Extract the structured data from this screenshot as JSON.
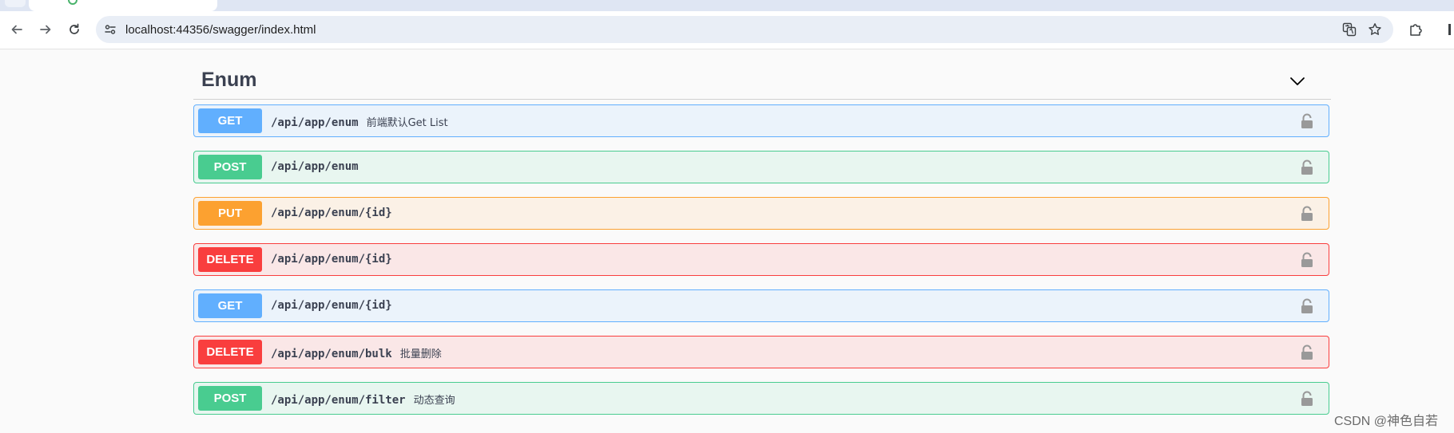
{
  "browser": {
    "url": "localhost:44356/swagger/index.html"
  },
  "section": {
    "title": "Enum"
  },
  "operations": [
    {
      "method": "GET",
      "path": "/api/app/enum",
      "summary": "前端默认Get List"
    },
    {
      "method": "POST",
      "path": "/api/app/enum",
      "summary": ""
    },
    {
      "method": "PUT",
      "path": "/api/app/enum/{id}",
      "summary": ""
    },
    {
      "method": "DELETE",
      "path": "/api/app/enum/{id}",
      "summary": ""
    },
    {
      "method": "GET",
      "path": "/api/app/enum/{id}",
      "summary": ""
    },
    {
      "method": "DELETE",
      "path": "/api/app/enum/bulk",
      "summary": "批量删除"
    },
    {
      "method": "POST",
      "path": "/api/app/enum/filter",
      "summary": "动态查询"
    }
  ],
  "watermark": "CSDN @神色自若",
  "colors": {
    "get": "#61affe",
    "post": "#49cc90",
    "put": "#fca130",
    "delete": "#f93e3e"
  },
  "icons": [
    "back-arrow-icon",
    "forward-arrow-icon",
    "reload-icon",
    "site-settings-icon",
    "translate-icon",
    "bookmark-star-icon",
    "extensions-icon",
    "chevron-down-icon",
    "lock-icon"
  ]
}
